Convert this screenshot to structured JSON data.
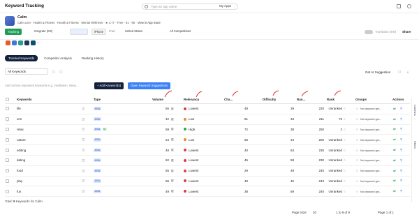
{
  "header": {
    "title": "Keyword Tracking",
    "search_placeholder": "Type an app name",
    "my_apps": "My Apps"
  },
  "app": {
    "name": "Calm",
    "meta": "Calm.com · Health & Fitness",
    "meta2": "Health & Fitness · Mental Wellness",
    "rating": "4.77",
    "price": "Free",
    "count": "81",
    "ver": "95",
    "store_link": "View in App Store"
  },
  "controls": {
    "tracking": "Tracking",
    "integrate": "Integrate (0/2)",
    "iphone": "iPhone",
    "ipad": "iPad",
    "country": "United States",
    "competitors": "All Competitions",
    "translation": "Translation (EN)",
    "share": "Share"
  },
  "tabs": [
    "Tracked Keywords",
    "Competitor Analysis",
    "Ranking History"
  ],
  "filters": {
    "all_keywords": "All Keywords",
    "ai": "Get AI Suggestion"
  },
  "kw_input_placeholder": "Add comma separated keywords e.g. meditation, sleep...",
  "buttons": {
    "add": "+ Add Keyword(s)",
    "open_suggestions": "Open Keyword Suggestions"
  },
  "columns": {
    "keywords": "Keywords",
    "type": "Type",
    "volume": "Volume",
    "relevancy": "Relevancy",
    "chance": "Cha...",
    "difficulty": "Difficulty",
    "rank_prev": "Ran...",
    "rank": "Rank",
    "groups": "Groups",
    "actions": "Actions"
  },
  "rows": [
    {
      "kw": "life",
      "vol": "55",
      "rel": "Lowest",
      "relc": "#e03b3b",
      "ch": "49",
      "dif": "39",
      "rp": "220",
      "rank": "Unranked",
      "grp": "No keyword gro...",
      "m": false
    },
    {
      "kw": "zen",
      "vol": "42",
      "rel": "Low",
      "relc": "#f08a24",
      "ch": "81",
      "dif": "33",
      "rp": "211",
      "rank": "75",
      "grp": "No keyword gro...",
      "m": false
    },
    {
      "kw": "relax",
      "vol": "59",
      "rel": "High",
      "relc": "#27a844",
      "ch": "72",
      "dif": "38",
      "rp": "250",
      "rank": "2",
      "grp": "No keyword gro...",
      "m": true
    },
    {
      "kw": "nature",
      "vol": "54",
      "rel": "Low",
      "relc": "#f08a24",
      "ch": "56",
      "dif": "34",
      "rp": "200",
      "rank": "Unranked",
      "grp": "No keyword gro...",
      "m": false
    },
    {
      "kw": "editing",
      "vol": "48",
      "rel": "Lowest",
      "relc": "#e03b3b",
      "ch": "40",
      "dif": "63",
      "rp": "235",
      "rank": "Unranked",
      "grp": "No keyword gro...",
      "m": false
    },
    {
      "kw": "dating",
      "vol": "62",
      "rel": "Lowest",
      "relc": "#e03b3b",
      "ch": "46",
      "dif": "58",
      "rp": "230",
      "rank": "Unranked",
      "grp": "No keyword gro...",
      "m": false
    },
    {
      "kw": "food",
      "vol": "55",
      "rel": "Lowest",
      "relc": "#e03b3b",
      "ch": "29",
      "dif": "49",
      "rp": "245",
      "rank": "Unranked",
      "grp": "No keyword gro...",
      "m": false
    },
    {
      "kw": "play",
      "vol": "56",
      "rel": "Lowest",
      "relc": "#e03b3b",
      "ch": "49",
      "dif": "45",
      "rp": "243",
      "rank": "Unranked",
      "grp": "No keyword gro...",
      "m": false
    },
    {
      "kw": "fun",
      "vol": "49",
      "rel": "Lowest",
      "relc": "#e03b3b",
      "ch": "38",
      "dif": "59",
      "rp": "240",
      "rank": "Unranked",
      "grp": "No keyword gro...",
      "m": false
    }
  ],
  "footer": {
    "total_prefix": "Total: ",
    "total_count": "9",
    "total_suffix": " Keywords for Calm",
    "page_size_label": "Page Size:",
    "page_size": "20",
    "range": "1 to 9 of 9",
    "page": "Page 1 of 1"
  },
  "sidebar": {
    "columns": "Columns",
    "filters": "Filters"
  }
}
